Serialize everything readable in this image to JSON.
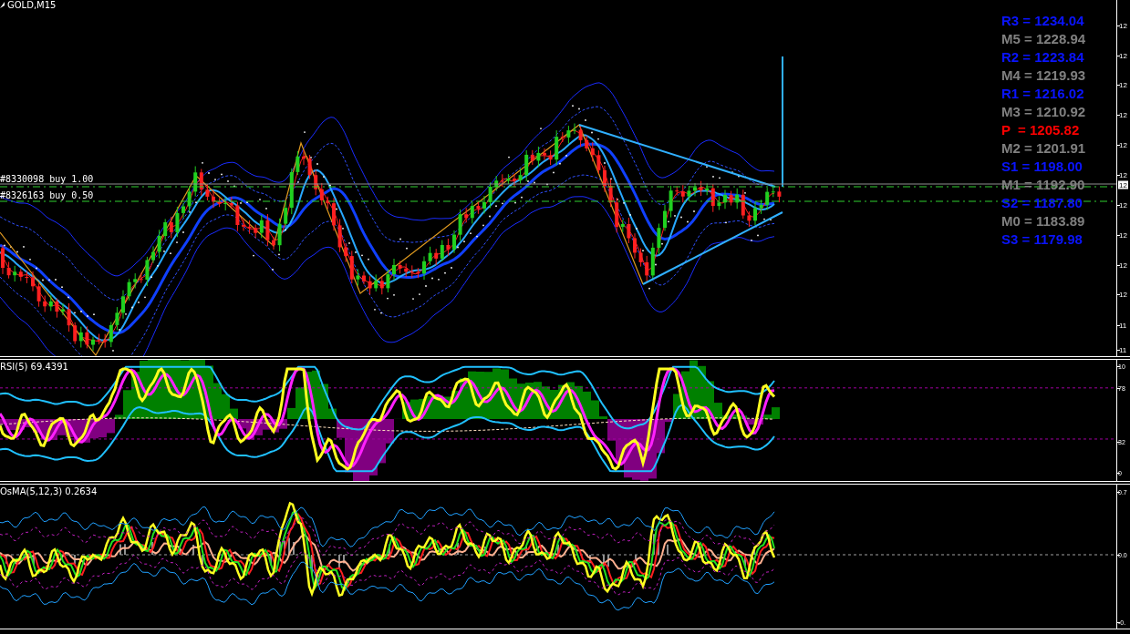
{
  "chart_title": "GOLD,M15",
  "orders": [
    {
      "label": "#8330098 buy 1.00"
    },
    {
      "label": "#8326163 buy 0.50"
    }
  ],
  "pivot_levels": [
    {
      "label": "R3 = 1234.04",
      "color": "#0a14ff"
    },
    {
      "label": "M5 = 1228.94",
      "color": "#808080"
    },
    {
      "label": "R2 = 1223.84",
      "color": "#0a14ff"
    },
    {
      "label": "M4 = 1219.93",
      "color": "#808080"
    },
    {
      "label": "R1 = 1216.02",
      "color": "#0a14ff"
    },
    {
      "label": "M3 = 1210.92",
      "color": "#808080"
    },
    {
      "label": "P  = 1205.82",
      "color": "#ff0000"
    },
    {
      "label": "M2 = 1201.91",
      "color": "#808080"
    },
    {
      "label": "S1 = 1198.00",
      "color": "#0a14ff"
    },
    {
      "label": "M1 = 1192.90",
      "color": "#808080"
    },
    {
      "label": "S2 = 1187.80",
      "color": "#0a14ff"
    },
    {
      "label": "M0 = 1183.89",
      "color": "#808080"
    },
    {
      "label": "S3 = 1179.98",
      "color": "#0a14ff"
    }
  ],
  "price_axis": {
    "labels": [
      "12",
      "12",
      "12",
      "12",
      "12",
      "12",
      "12",
      "12",
      "12",
      "12",
      "11",
      "11"
    ],
    "current_price": "12"
  },
  "rsi": {
    "title": "RSI(5) 69.4391",
    "axis_labels": [
      "10",
      "78",
      "32",
      "0"
    ]
  },
  "osma": {
    "title": "OsMA(5,12,3) 0.2634",
    "axis_labels": [
      "0.7",
      "0.0",
      "-0."
    ]
  }
}
